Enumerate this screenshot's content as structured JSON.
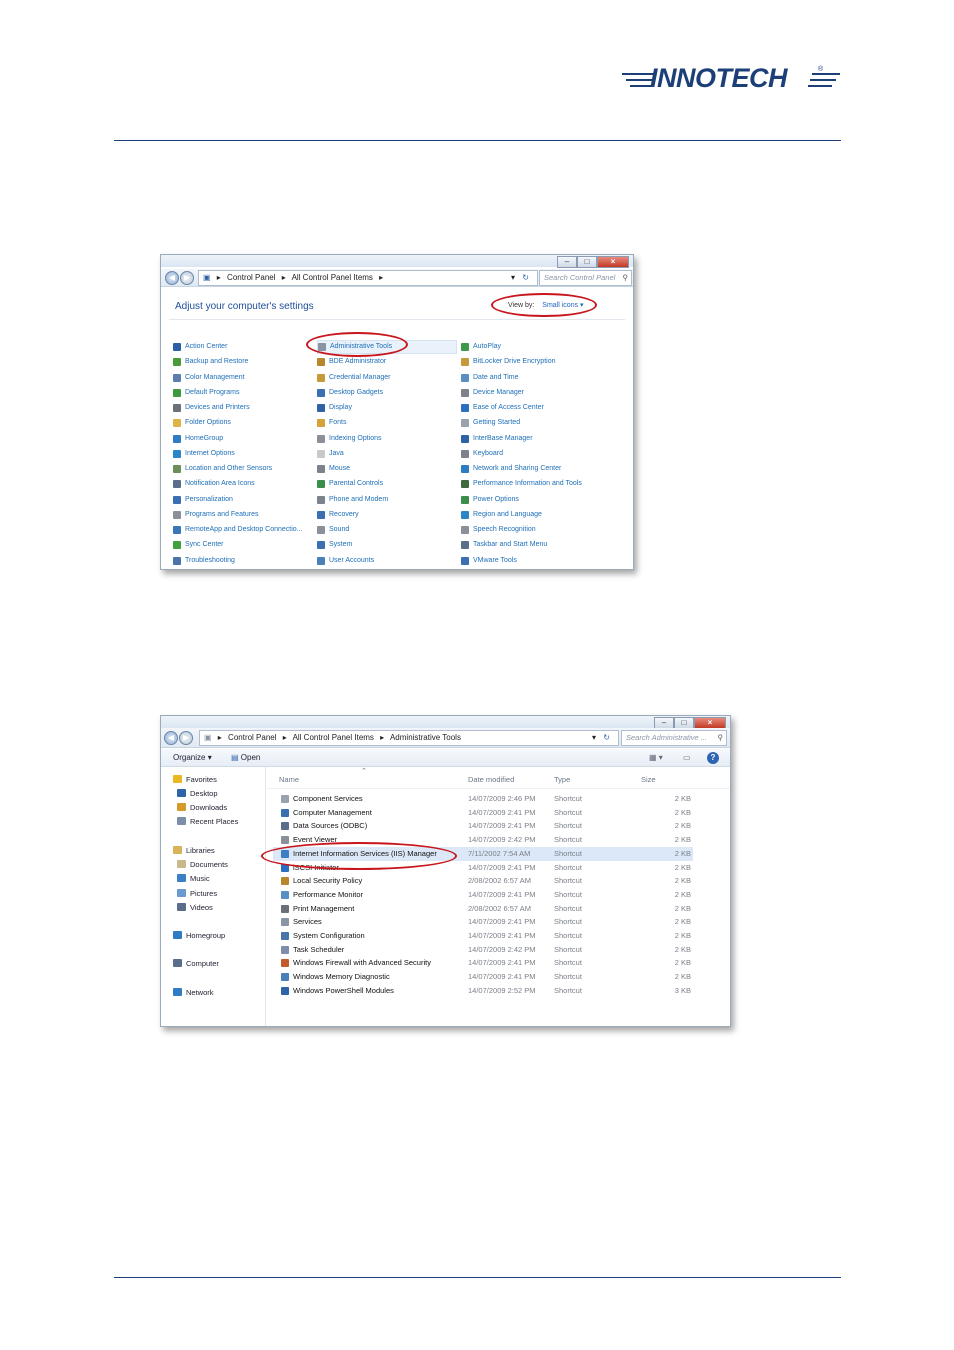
{
  "header": {
    "logo_text": "INNOTECH",
    "registered_mark": "®",
    "brand_color": "#1c3f78"
  },
  "control_panel_window": {
    "caption_buttons": [
      "–",
      "□",
      "×"
    ],
    "breadcrumb": [
      "Control Panel",
      "All Control Panel Items"
    ],
    "search_placeholder": "Search Control Panel",
    "heading": "Adjust your computer's settings",
    "view_by_label": "View by:",
    "view_by_value": "Small icons",
    "columns": [
      [
        {
          "label": "Action Center",
          "icon": "flag-icon",
          "color": "#2b5fa8"
        },
        {
          "label": "Backup and Restore",
          "icon": "backup-icon",
          "color": "#4a9a3a"
        },
        {
          "label": "Color Management",
          "icon": "monitor-icon",
          "color": "#5b7db0"
        },
        {
          "label": "Default Programs",
          "icon": "default-programs-icon",
          "color": "#3f9a3f"
        },
        {
          "label": "Devices and Printers",
          "icon": "printer-icon",
          "color": "#6a6f7a"
        },
        {
          "label": "Folder Options",
          "icon": "folder-icon",
          "color": "#e0b24a"
        },
        {
          "label": "HomeGroup",
          "icon": "homegroup-icon",
          "color": "#2d7cc4"
        },
        {
          "label": "Internet Options",
          "icon": "globe-icon",
          "color": "#2a86c9"
        },
        {
          "label": "Location and Other Sensors",
          "icon": "sensor-icon",
          "color": "#6b8f5a"
        },
        {
          "label": "Notification Area Icons",
          "icon": "taskbar-icon",
          "color": "#5a6d8a"
        },
        {
          "label": "Personalization",
          "icon": "personalization-icon",
          "color": "#3b6fb2"
        },
        {
          "label": "Programs and Features",
          "icon": "programs-icon",
          "color": "#8a8f99"
        },
        {
          "label": "RemoteApp and Desktop Connectio...",
          "icon": "remote-desktop-icon",
          "color": "#3a77b8"
        },
        {
          "label": "Sync Center",
          "icon": "sync-icon",
          "color": "#3da23d"
        },
        {
          "label": "Troubleshooting",
          "icon": "troubleshooting-icon",
          "color": "#4b74a8"
        }
      ],
      [
        {
          "label": "Administrative Tools",
          "icon": "admin-tools-icon",
          "color": "#8a94a3"
        },
        {
          "label": "BDE Administrator",
          "icon": "database-icon",
          "color": "#b8862d"
        },
        {
          "label": "Credential Manager",
          "icon": "credential-icon",
          "color": "#c49a3a"
        },
        {
          "label": "Desktop Gadgets",
          "icon": "gadgets-icon",
          "color": "#3b6fb2"
        },
        {
          "label": "Display",
          "icon": "display-icon",
          "color": "#2f63a8"
        },
        {
          "label": "Fonts",
          "icon": "fonts-icon",
          "color": "#d6a33a"
        },
        {
          "label": "Indexing Options",
          "icon": "indexing-icon",
          "color": "#8a8f99"
        },
        {
          "label": "Java",
          "icon": "java-icon",
          "color": "#c9c9c9"
        },
        {
          "label": "Mouse",
          "icon": "mouse-icon",
          "color": "#7d828c"
        },
        {
          "label": "Parental Controls",
          "icon": "parental-icon",
          "color": "#3c8f4a"
        },
        {
          "label": "Phone and Modem",
          "icon": "phone-icon",
          "color": "#7d828c"
        },
        {
          "label": "Recovery",
          "icon": "recovery-icon",
          "color": "#3b6fb2"
        },
        {
          "label": "Sound",
          "icon": "sound-icon",
          "color": "#8a8f99"
        },
        {
          "label": "System",
          "icon": "system-icon",
          "color": "#3b6fb2"
        },
        {
          "label": "User Accounts",
          "icon": "users-icon",
          "color": "#4a7fb8"
        }
      ],
      [
        {
          "label": "AutoPlay",
          "icon": "autoplay-icon",
          "color": "#3d9a4a"
        },
        {
          "label": "BitLocker Drive Encryption",
          "icon": "bitlocker-icon",
          "color": "#c49a3a"
        },
        {
          "label": "Date and Time",
          "icon": "clock-icon",
          "color": "#5a8fc4"
        },
        {
          "label": "Device Manager",
          "icon": "device-manager-icon",
          "color": "#7d828c"
        },
        {
          "label": "Ease of Access Center",
          "icon": "ease-access-icon",
          "color": "#2a6fc0"
        },
        {
          "label": "Getting Started",
          "icon": "getting-started-icon",
          "color": "#9aa3ad"
        },
        {
          "label": "InterBase Manager",
          "icon": "interbase-icon",
          "color": "#2f63a8"
        },
        {
          "label": "Keyboard",
          "icon": "keyboard-icon",
          "color": "#7d828c"
        },
        {
          "label": "Network and Sharing Center",
          "icon": "network-icon",
          "color": "#2d7cc4"
        },
        {
          "label": "Performance Information and Tools",
          "icon": "performance-icon",
          "color": "#3f6a3f"
        },
        {
          "label": "Power Options",
          "icon": "power-icon",
          "color": "#3c8f4a"
        },
        {
          "label": "Region and Language",
          "icon": "region-icon",
          "color": "#2a86c9"
        },
        {
          "label": "Speech Recognition",
          "icon": "microphone-icon",
          "color": "#8a8f99"
        },
        {
          "label": "Taskbar and Start Menu",
          "icon": "taskbar-start-icon",
          "color": "#5a6d8a"
        },
        {
          "label": "VMware Tools",
          "icon": "vmware-icon",
          "color": "#3b6fb2"
        }
      ]
    ]
  },
  "admin_tools_window": {
    "caption_buttons": [
      "–",
      "□",
      "×"
    ],
    "breadcrumb": [
      "Control Panel",
      "All Control Panel Items",
      "Administrative Tools"
    ],
    "search_placeholder": "Search Administrative ...",
    "toolbar": {
      "organize": "Organize",
      "open": "Open"
    },
    "nav": {
      "favorites": "Favorites",
      "desktop": "Desktop",
      "downloads": "Downloads",
      "recent_places": "Recent Places",
      "libraries": "Libraries",
      "documents": "Documents",
      "music": "Music",
      "pictures": "Pictures",
      "videos": "Videos",
      "homegroup": "Homegroup",
      "computer": "Computer",
      "network": "Network"
    },
    "columns": {
      "name": "Name",
      "date": "Date modified",
      "type": "Type",
      "size": "Size"
    },
    "files": [
      {
        "name": "Component Services",
        "date": "14/07/2009 2:46 PM",
        "type": "Shortcut",
        "size": "2 KB"
      },
      {
        "name": "Computer Management",
        "date": "14/07/2009 2:41 PM",
        "type": "Shortcut",
        "size": "2 KB"
      },
      {
        "name": "Data Sources (ODBC)",
        "date": "14/07/2009 2:41 PM",
        "type": "Shortcut",
        "size": "2 KB"
      },
      {
        "name": "Event Viewer",
        "date": "14/07/2009 2:42 PM",
        "type": "Shortcut",
        "size": "2 KB"
      },
      {
        "name": "Internet Information Services (IIS) Manager",
        "date": "7/11/2002 7:54 AM",
        "type": "Shortcut",
        "size": "2 KB"
      },
      {
        "name": "iSCSI Initiator",
        "date": "14/07/2009 2:41 PM",
        "type": "Shortcut",
        "size": "2 KB"
      },
      {
        "name": "Local Security Policy",
        "date": "2/08/2002 6:57 AM",
        "type": "Shortcut",
        "size": "2 KB"
      },
      {
        "name": "Performance Monitor",
        "date": "14/07/2009 2:41 PM",
        "type": "Shortcut",
        "size": "2 KB"
      },
      {
        "name": "Print Management",
        "date": "2/08/2002 6:57 AM",
        "type": "Shortcut",
        "size": "2 KB"
      },
      {
        "name": "Services",
        "date": "14/07/2009 2:41 PM",
        "type": "Shortcut",
        "size": "2 KB"
      },
      {
        "name": "System Configuration",
        "date": "14/07/2009 2:41 PM",
        "type": "Shortcut",
        "size": "2 KB"
      },
      {
        "name": "Task Scheduler",
        "date": "14/07/2009 2:42 PM",
        "type": "Shortcut",
        "size": "2 KB"
      },
      {
        "name": "Windows Firewall with Advanced Security",
        "date": "14/07/2009 2:41 PM",
        "type": "Shortcut",
        "size": "2 KB"
      },
      {
        "name": "Windows Memory Diagnostic",
        "date": "14/07/2009 2:41 PM",
        "type": "Shortcut",
        "size": "2 KB"
      },
      {
        "name": "Windows PowerShell Modules",
        "date": "14/07/2009 2:52 PM",
        "type": "Shortcut",
        "size": "3 KB"
      }
    ]
  }
}
